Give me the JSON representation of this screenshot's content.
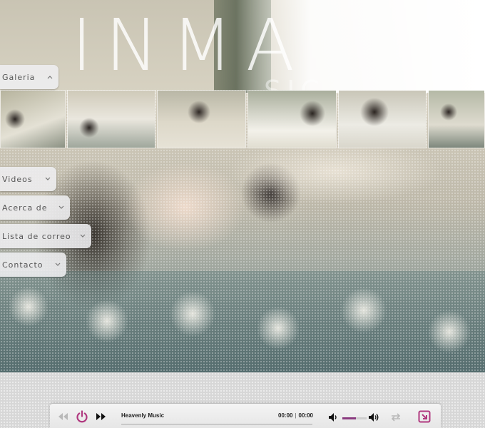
{
  "site": {
    "title": "INMA",
    "subtitle": "SIC"
  },
  "nav": {
    "galeria": "Galeria",
    "videos": "Videos",
    "acerca": "Acerca de",
    "lista": "Lista de correo",
    "contacto": "Contacto"
  },
  "gallery": {
    "thumb_count": 6
  },
  "player": {
    "track_title": "Heavenly Music",
    "current_time": "00:00",
    "separator": "|",
    "duration": "00:00",
    "progress": 0,
    "volume": 0.55,
    "icons": {
      "prev": "rewind-icon",
      "power": "power-icon",
      "next": "fast-forward-icon",
      "volume_down": "volume-low-icon",
      "volume_up": "volume-high-icon",
      "repeat": "repeat-icon",
      "popout": "popout-icon"
    }
  },
  "colors": {
    "accent": "#b0387f",
    "volume_fill": "#8a3a7f",
    "tab_text": "#555555"
  }
}
